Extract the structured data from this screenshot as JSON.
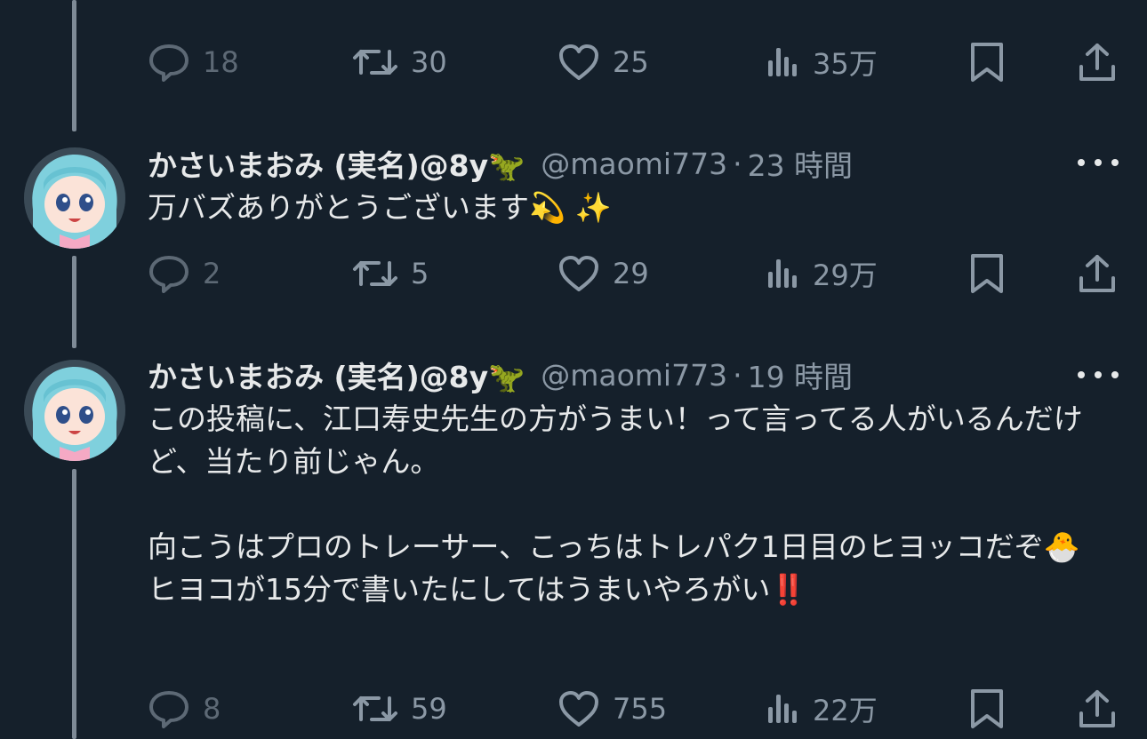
{
  "tweets": [
    {
      "id": 0,
      "actions": {
        "replies": "18",
        "retweets": "30",
        "likes": "25",
        "views": "35万"
      }
    },
    {
      "id": 1,
      "display_name": "かさいまおみ (実名)@8y🦖",
      "handle": "@maomi773",
      "separator": "·",
      "time": "23 時間",
      "text": "万バズありがとうございます💫 ✨",
      "actions": {
        "replies": "2",
        "retweets": "5",
        "likes": "29",
        "views": "29万"
      }
    },
    {
      "id": 2,
      "display_name": "かさいまおみ (実名)@8y🦖",
      "handle": "@maomi773",
      "separator": "·",
      "time": "19 時間",
      "text": "この投稿に、江口寿史先生の方がうまい！って言ってる人がいるんだけど、当たり前じゃん。\n\n向こうはプロのトレーサー、こっちはトレパク1日目のヒヨッコだぞ🐣\nヒヨコが15分で書いたにしてはうまいやろがい‼️",
      "actions": {
        "replies": "8",
        "retweets": "59",
        "likes": "755",
        "views": "22万"
      }
    }
  ],
  "colors": {
    "background": "#15202b",
    "text_primary": "#e7e9ea",
    "text_secondary": "#8b98a5",
    "thread_line": "#7e8a96"
  }
}
